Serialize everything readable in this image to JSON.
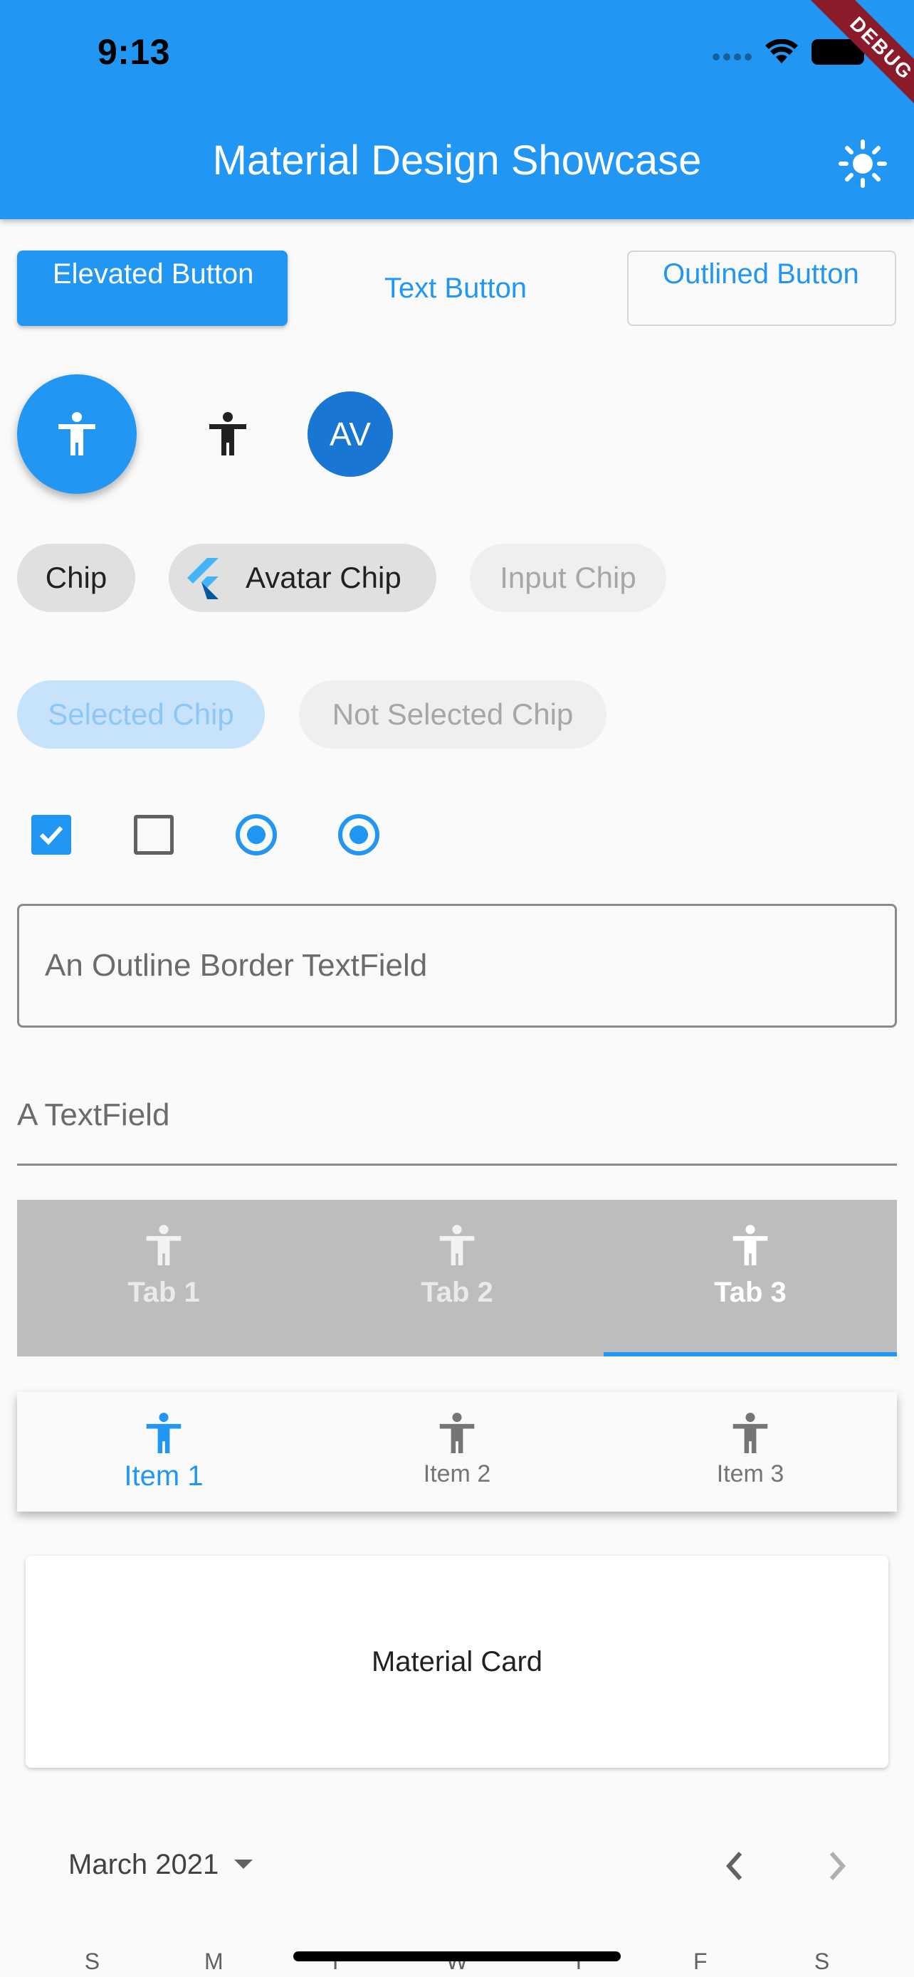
{
  "status_bar": {
    "time": "9:13"
  },
  "app_bar": {
    "title": "Material Design Showcase",
    "theme_icon": "brightness-icon",
    "debug_banner": "DEBUG",
    "color": "#2196f3"
  },
  "buttons": {
    "elevated": "Elevated Button",
    "text": "Text Button",
    "outlined": "Outlined Button"
  },
  "icons_row": {
    "fab_icon": "accessibility-icon",
    "icon_button": "accessibility-icon",
    "avatar": "AV"
  },
  "chips": {
    "chip": "Chip",
    "avatar_chip": "Avatar Chip",
    "input_chip": "Input Chip",
    "selected_chip": "Selected Chip",
    "not_selected_chip": "Not Selected Chip"
  },
  "selection_controls": {
    "checkbox_1_checked": true,
    "checkbox_2_checked": false,
    "radio_1_selected": true,
    "radio_2_selected": true
  },
  "text_fields": {
    "outline_placeholder": "An Outline Border TextField",
    "underline_placeholder": "A TextField"
  },
  "tabs": [
    {
      "label": "Tab 1",
      "icon": "accessibility-icon",
      "active": false
    },
    {
      "label": "Tab 2",
      "icon": "accessibility-icon",
      "active": false
    },
    {
      "label": "Tab 3",
      "icon": "accessibility-icon",
      "active": true
    }
  ],
  "bottom_nav": [
    {
      "label": "Item 1",
      "icon": "accessibility-icon",
      "active": true
    },
    {
      "label": "Item 2",
      "icon": "accessibility-icon",
      "active": false
    },
    {
      "label": "Item 3",
      "icon": "accessibility-icon",
      "active": false
    }
  ],
  "card": {
    "label": "Material Card"
  },
  "calendar": {
    "month": "March 2021",
    "weekdays": [
      "S",
      "M",
      "T",
      "W",
      "T",
      "F",
      "S"
    ]
  }
}
